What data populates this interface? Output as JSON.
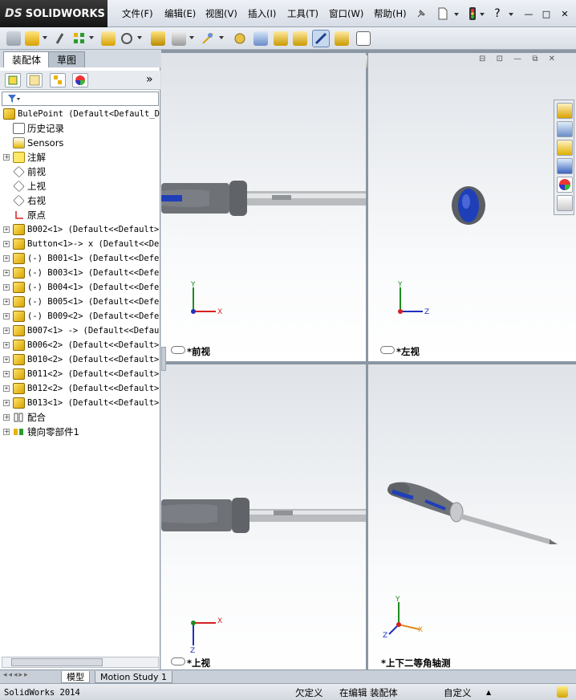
{
  "app": {
    "brand_ds": "DS",
    "brand_name": "SOLIDWORKS"
  },
  "menu": [
    "文件(F)",
    "编辑(E)",
    "视图(V)",
    "插入(I)",
    "工具(T)",
    "窗口(W)",
    "帮助(H)"
  ],
  "window_controls": {
    "question": "?",
    "minimize": "—",
    "restore": "□",
    "close": "✕"
  },
  "panel_tabs": {
    "assembly": "装配体",
    "sketch": "草图"
  },
  "fm_toggle": "»",
  "tree": {
    "root": "BulePoint  (Default<Default_D",
    "items": [
      {
        "label": "历史记录",
        "icon": "history-icon",
        "exp": false
      },
      {
        "label": "Sensors",
        "icon": "sensors-icon",
        "exp": false
      },
      {
        "label": "注解",
        "icon": "annotations-icon",
        "exp": true
      },
      {
        "label": "前视",
        "icon": "plane-icon",
        "exp": false
      },
      {
        "label": "上视",
        "icon": "plane-icon",
        "exp": false
      },
      {
        "label": "右视",
        "icon": "plane-icon",
        "exp": false
      },
      {
        "label": "原点",
        "icon": "origin-icon",
        "exp": false
      },
      {
        "label": "B002<1> (Default<<Default>",
        "icon": "part-icon",
        "exp": true
      },
      {
        "label": "Button<1>-> x (Default<<De",
        "icon": "part-icon",
        "exp": true
      },
      {
        "label": "(-) B001<1> (Default<<Defe",
        "icon": "part-icon",
        "exp": true
      },
      {
        "label": "(-) B003<1> (Default<<Defe",
        "icon": "part-icon",
        "exp": true
      },
      {
        "label": "(-) B004<1> (Default<<Defe",
        "icon": "part-icon",
        "exp": true
      },
      {
        "label": "(-) B005<1> (Default<<Defe",
        "icon": "part-icon",
        "exp": true
      },
      {
        "label": "(-) B009<2> (Default<<Defe",
        "icon": "part-icon",
        "exp": true
      },
      {
        "label": "B007<1> -> (Default<<Defau",
        "icon": "part-icon",
        "exp": true
      },
      {
        "label": "B006<2> (Default<<Default>",
        "icon": "part-icon",
        "exp": true
      },
      {
        "label": "B010<2> (Default<<Default>",
        "icon": "part-icon",
        "exp": true
      },
      {
        "label": "B011<2> (Default<<Default>",
        "icon": "part-icon",
        "exp": true
      },
      {
        "label": "B012<2> (Default<<Default>",
        "icon": "part-icon",
        "exp": true
      },
      {
        "label": "B013<1> (Default<<Default>",
        "icon": "part-icon",
        "exp": true
      },
      {
        "label": "配合",
        "icon": "mates-icon",
        "exp": true
      },
      {
        "label": "镜向零部件1",
        "icon": "mirror-icon",
        "exp": true
      }
    ]
  },
  "viewports": {
    "front": "*前视",
    "left": "*左视",
    "top": "*上视",
    "iso": "*上下二等角轴测"
  },
  "axes": {
    "x": "X",
    "y": "Y",
    "z": "Z"
  },
  "bottom_tabs": {
    "model": "模型",
    "motion": "Motion Study 1"
  },
  "status": {
    "app": "SolidWorks 2014",
    "underdefined": "欠定义",
    "editing": "在编辑 装配体",
    "custom": "自定义"
  },
  "colors": {
    "accent_blue": "#1f3fb8",
    "handle_gray": "#6e7176",
    "axis_red": "#d62020",
    "axis_green": "#1f8c1f",
    "axis_blue": "#2030c0"
  }
}
